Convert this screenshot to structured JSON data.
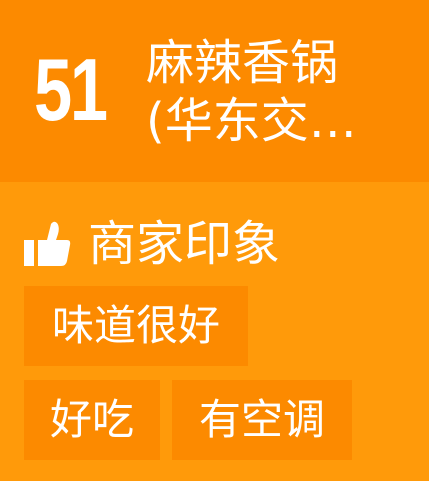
{
  "card": {
    "rank": "51",
    "restaurant_name": "麻辣香锅(华东交…",
    "impression_title": "商家印象",
    "tags": [
      "味道很好",
      "好吃",
      "有空调"
    ],
    "icon_name": "thumbs-up-icon",
    "colors": {
      "header_bg": "#fc8a00",
      "body_bg": "#ff9a0a",
      "text": "#ffffff"
    }
  }
}
